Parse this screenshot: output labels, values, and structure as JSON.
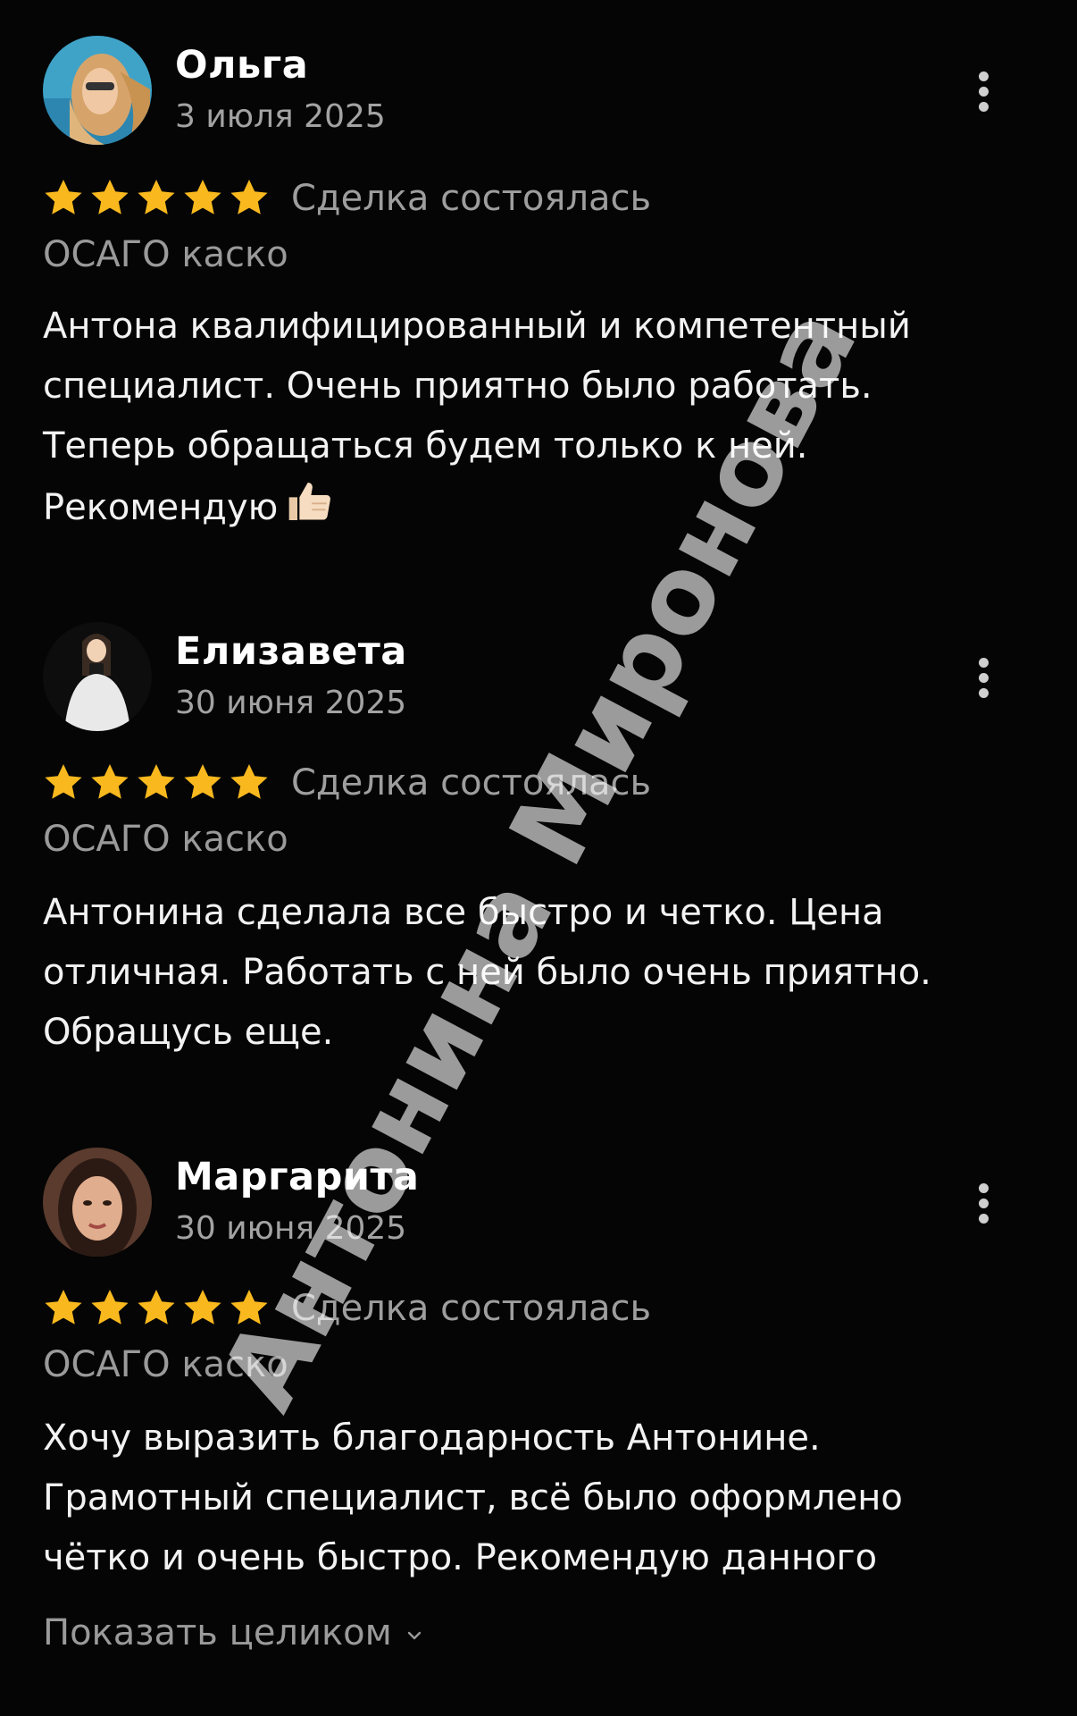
{
  "reviews": [
    {
      "author": "Ольга",
      "date": "3 июля 2025",
      "avatar_icon": "user-photo-avatar",
      "rating": 5,
      "rating_max": 5,
      "status": "Сделка состоялась",
      "service": "ОСАГО каско",
      "text_lines": [
        "Антона квалифицированный и компетентный",
        "специалист. Очень приятно было работать.",
        "Теперь обращаться будем только к ней.",
        "Рекомендую"
      ],
      "trailing_emoji": "thumbs-up-icon"
    },
    {
      "author": "Елизавета",
      "date": "30 июня 2025",
      "avatar_icon": "user-photo-avatar",
      "rating": 5,
      "rating_max": 5,
      "status": "Сделка состоялась",
      "service": "ОСАГО каско",
      "text_lines": [
        "Антонина сделала все быстро и четко. Цена",
        "отличная. Работать с ней было очень приятно.",
        "Обращусь еще."
      ]
    },
    {
      "author": "Маргарита",
      "date": "30 июня 2025",
      "avatar_icon": "user-photo-avatar",
      "rating": 5,
      "rating_max": 5,
      "status": "Сделка состоялась",
      "service": "ОСАГО каско",
      "text_lines": [
        "Хочу выразить благодарность Антонине.",
        "Грамотный специалист, всё было оформлено",
        "чётко и очень быстро. Рекомендую данного"
      ],
      "show_full": "Показать целиком"
    }
  ],
  "watermark": "Антонина Миронова",
  "colors": {
    "background": "#050505",
    "star": "#f9b91e",
    "secondary_text": "#9e9e9e"
  }
}
